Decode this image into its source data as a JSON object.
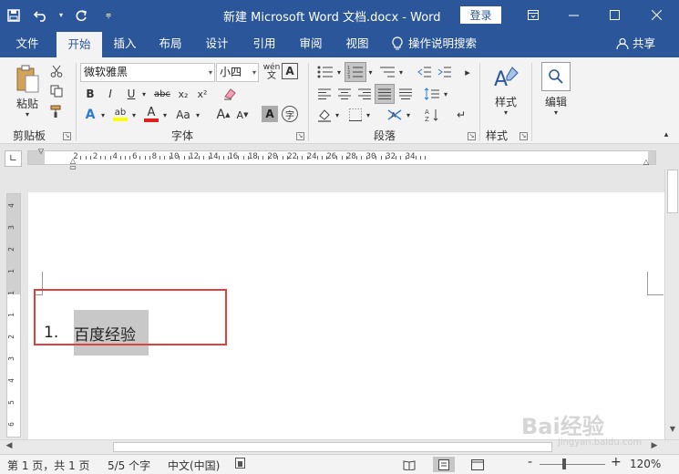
{
  "window": {
    "title": "新建 Microsoft Word 文档.docx  -  Word",
    "login_label": "登录",
    "qat": {
      "save_icon": "save-icon",
      "undo_icon": "undo-icon",
      "redo_icon": "redo-icon",
      "customize_icon": "customize-icon"
    }
  },
  "tabs": {
    "file": "文件",
    "home": "开始",
    "insert": "插入",
    "layout": "布局",
    "design": "设计",
    "references": "引用",
    "review": "审阅",
    "view": "视图",
    "tell_me": "操作说明搜索",
    "share": "共享"
  },
  "ribbon": {
    "clipboard": {
      "label": "剪贴板",
      "paste": "粘贴"
    },
    "font": {
      "label": "字体",
      "font_name": "微软雅黑",
      "font_size": "小四",
      "wen_glyph": "wén",
      "bold": "B",
      "italic": "I",
      "underline": "U",
      "strike": "abc",
      "subscript": "x₂",
      "superscript": "x²",
      "text_effect": "A",
      "highlight": "ab",
      "font_color": "A",
      "change_case": "Aa",
      "grow": "A",
      "shrink": "A",
      "char_shading": "A",
      "enclose": "字"
    },
    "paragraph": {
      "label": "段落"
    },
    "styles": {
      "label": "样式",
      "button": "样式"
    },
    "editing": {
      "button": "编辑"
    }
  },
  "ruler": {
    "numbers": [
      "2",
      "2",
      "4",
      "6",
      "8",
      "10",
      "12",
      "14",
      "16",
      "18",
      "20",
      "22",
      "24",
      "26",
      "28",
      "30",
      "32",
      "34"
    ],
    "vertical_numbers": [
      "4",
      "3",
      "2",
      "1",
      "1",
      "1",
      "2",
      "3",
      "4",
      "5",
      "6"
    ]
  },
  "document": {
    "list_number": "1.",
    "list_text": "百度经验"
  },
  "status": {
    "page": "第 1 页，共 1 页",
    "words": "5/5 个字",
    "language": "中文(中国)",
    "zoom": "120%",
    "zoom_minus": "-",
    "zoom_plus": "+"
  },
  "watermark": {
    "brand": "Bai经验",
    "url": "jingyan.baidu.com"
  }
}
